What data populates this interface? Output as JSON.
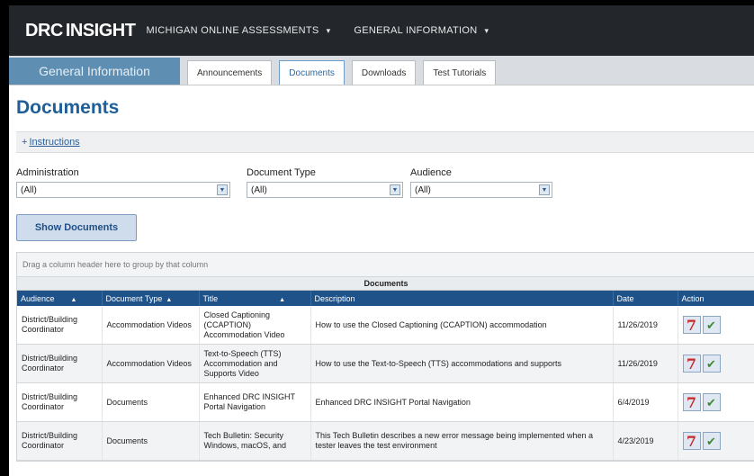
{
  "header": {
    "logo_left": "DRC",
    "logo_right": "INSIGHT",
    "nav_primary": "MICHIGAN ONLINE ASSESSMENTS",
    "nav_secondary": "GENERAL INFORMATION",
    "caret": "▾"
  },
  "tabs": {
    "section": "General Information",
    "items": [
      {
        "label": "Announcements"
      },
      {
        "label": "Documents",
        "active": true
      },
      {
        "label": "Downloads"
      },
      {
        "label": "Test Tutorials"
      }
    ]
  },
  "page": {
    "title": "Documents"
  },
  "instructions": {
    "label": "Instructions",
    "toggle": "+"
  },
  "filters": {
    "administration": {
      "label": "Administration",
      "value": "(All)"
    },
    "document_type": {
      "label": "Document Type",
      "value": "(All)"
    },
    "audience": {
      "label": "Audience",
      "value": "(All)"
    }
  },
  "show_button": "Show Documents",
  "grid": {
    "group_hint": "Drag a column header here to group by that column",
    "title": "Documents",
    "columns": [
      "Audience",
      "Document Type",
      "Title",
      "Description",
      "Date",
      "Action"
    ],
    "rows": [
      {
        "audience": "District/Building Coordinator",
        "type": "Accommodation Videos",
        "title": "Closed Captioning (CCAPTION) Accommodation Video",
        "description": "How to use the Closed Captioning (CCAPTION) accommodation",
        "date": "11/26/2019"
      },
      {
        "audience": "District/Building Coordinator",
        "type": "Accommodation Videos",
        "title": "Text-to-Speech (TTS) Accommodation and Supports Video",
        "description": "How to use the Text-to-Speech (TTS) accommodations and supports",
        "date": "11/26/2019"
      },
      {
        "audience": "District/Building Coordinator",
        "type": "Documents",
        "title": "Enhanced DRC INSIGHT Portal Navigation",
        "description": "Enhanced DRC INSIGHT Portal Navigation",
        "date": "6/4/2019"
      },
      {
        "audience": "District/Building Coordinator",
        "type": "Documents",
        "title": "Tech Bulletin: Security Windows, macOS, and",
        "description": "This Tech Bulletin describes a new error message being implemented when a tester leaves the test environment",
        "date": "4/23/2019"
      }
    ]
  },
  "colors": {
    "brand_blue": "#1f5f97",
    "header_dark": "#23272c",
    "table_header": "#1f5289"
  }
}
